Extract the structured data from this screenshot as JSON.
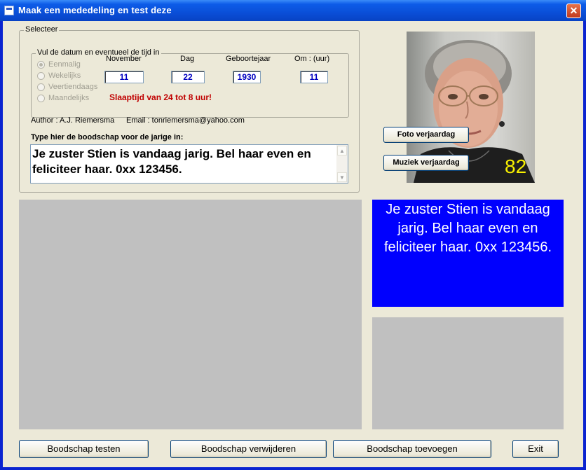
{
  "window": {
    "title": "Maak een mededeling en test deze",
    "close_glyph": "✕"
  },
  "selecteer": {
    "legend": "Selecteer",
    "inner_legend": "Vul de datum en eventueel de tijd in",
    "radios": [
      "Eenmalig",
      "Wekelijks",
      "Veertiendaags",
      "Maandelijks"
    ],
    "selected_radio": "Eenmalig",
    "columns": {
      "month": {
        "label": "November",
        "value": "11"
      },
      "day": {
        "label": "Dag",
        "value": "22"
      },
      "year": {
        "label": "Geboortejaar",
        "value": "1930"
      },
      "hour": {
        "label": "Om : (uur)",
        "value": "11"
      }
    },
    "warning": "Slaaptijd van 24 tot 8 uur!",
    "author": "Author :  A.J. Riemersma",
    "email": "Email :  tonriemersma@yahoo.com",
    "message_label": "Type hier de boodschap voor de jarige in:",
    "message_text": "Je zuster Stien is vandaag jarig. Bel haar even en feliciteer haar. 0xx 123456."
  },
  "photo": {
    "age": "82",
    "foto_button": "Foto verjaardag",
    "muziek_button": "Muziek verjaardag"
  },
  "preview": {
    "text": "Je zuster Stien is vandaag jarig. Bel haar even en feliciteer haar. 0xx 123456.",
    "bg_color": "#0000fe"
  },
  "bottom_buttons": {
    "test": "Boodschap testen",
    "delete": "Boodschap verwijderen",
    "add": "Boodschap toevoegen",
    "exit": "Exit"
  }
}
